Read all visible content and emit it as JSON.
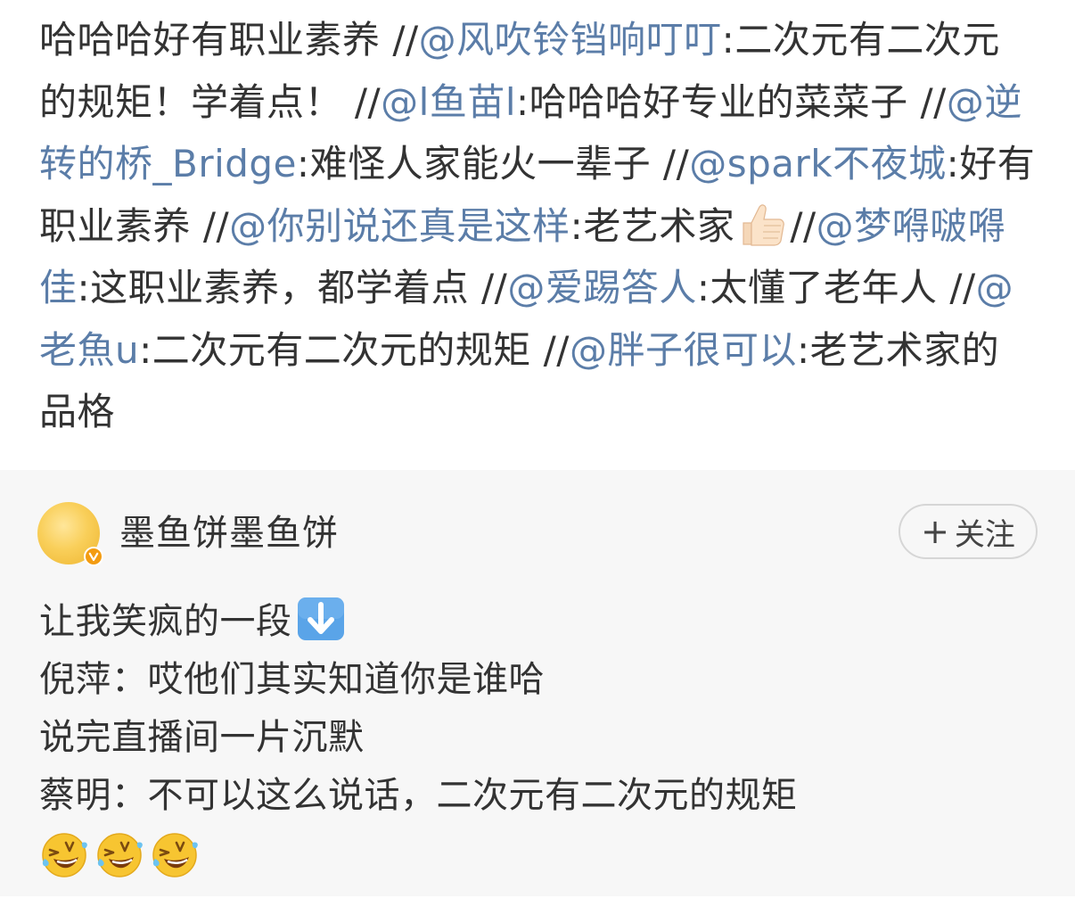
{
  "repost_chain": [
    {
      "type": "text",
      "text": "哈哈哈好有职业素养 //"
    },
    {
      "type": "mention",
      "text": "@风吹铃铛响叮叮"
    },
    {
      "type": "text",
      "text": ":二次元有二次元的规矩！学着点！ //"
    },
    {
      "type": "mention",
      "text": "@l鱼苗l"
    },
    {
      "type": "text",
      "text": ":哈哈哈好专业的菜菜子 //"
    },
    {
      "type": "mention",
      "text": "@逆转的桥_Bridge"
    },
    {
      "type": "text",
      "text": ":难怪人家能火一辈子 //"
    },
    {
      "type": "mention",
      "text": "@spark不夜城"
    },
    {
      "type": "text",
      "text": ":好有职业素养 //"
    },
    {
      "type": "mention",
      "text": "@你别说还真是这样"
    },
    {
      "type": "text",
      "text": ":老艺术家"
    },
    {
      "type": "emoji",
      "icon": "thumbs-up-icon"
    },
    {
      "type": "text",
      "text": "//"
    },
    {
      "type": "mention",
      "text": "@梦嘚啵嘚佳"
    },
    {
      "type": "text",
      "text": ":这职业素养，都学着点 //"
    },
    {
      "type": "mention",
      "text": "@爱踢答人"
    },
    {
      "type": "text",
      "text": ":太懂了老年人 //"
    },
    {
      "type": "mention",
      "text": "@老魚u"
    },
    {
      "type": "text",
      "text": ":二次元有二次元的规矩 //"
    },
    {
      "type": "mention",
      "text": "@胖子很可以"
    },
    {
      "type": "text",
      "text": ":老艺术家的品格"
    }
  ],
  "original_post": {
    "author": {
      "name": "墨鱼饼墨鱼饼",
      "avatar_icon": "yellow-circle-avatar",
      "badge_icon": "verified-v-badge-icon"
    },
    "follow_button": {
      "plus": "+",
      "label": "关注"
    },
    "lines": [
      "让我笑疯的一段",
      "倪萍：哎他们其实知道你是谁哈",
      "说完直播间一片沉默",
      "蔡明：不可以这么说话，二次元有二次元的规矩"
    ],
    "line1_emoji": "down-arrow-icon",
    "reaction_emojis": [
      "rofl-icon",
      "rofl-icon",
      "rofl-icon"
    ]
  },
  "colors": {
    "mention": "#5b7da8",
    "text": "#333333",
    "original_bg": "#f7f7f7",
    "badge_orange": "#f39c12",
    "arrow_blue": "#5aa4e8"
  }
}
